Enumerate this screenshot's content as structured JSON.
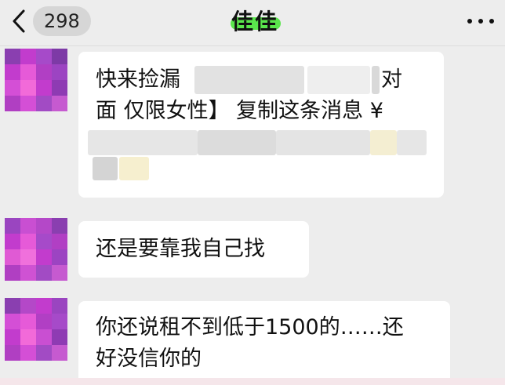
{
  "header": {
    "unread_count": "298",
    "chat_title": "佳佳"
  },
  "messages": [
    {
      "line1": "快来捡漏",
      "line1_end": "对",
      "line2": "面 仅限女性】 复制这条消息 ¥"
    },
    {
      "text": "还是要靠我自己找"
    },
    {
      "line1": "你还说租不到低于1500的……还",
      "line2": "好没信你的"
    }
  ],
  "colors": {
    "background": "#ededed",
    "bubble": "#ffffff",
    "title_highlight": "#5ae64c",
    "avatar_magenta": "#c23ccd"
  }
}
